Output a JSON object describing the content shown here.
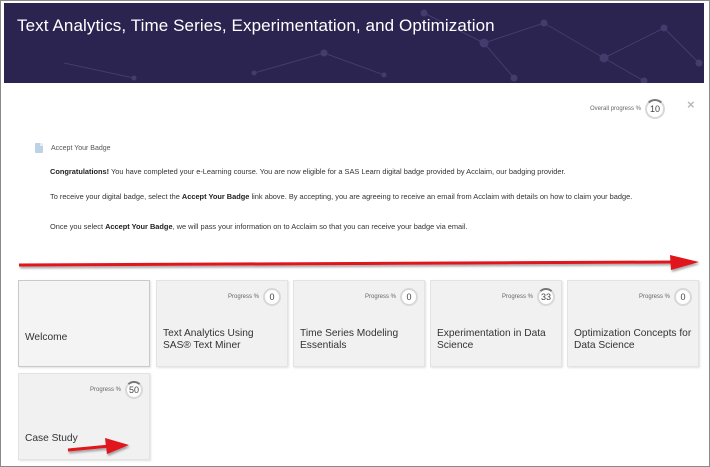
{
  "header": {
    "title": "Text Analytics, Time Series, Experimentation, and Optimization"
  },
  "overall": {
    "label": "Overall progress %",
    "value": "10"
  },
  "close": {
    "glyph": "×"
  },
  "badge": {
    "link_text": "Accept Your Badge",
    "para1_strong": "Congratulations!",
    "para1_rest": " You have completed your e-Learning course. You are now eligible for a SAS Learn digital badge provided by Acclaim, our badging provider.",
    "para2_a": "To receive your digital badge, select the ",
    "para2_strong": "Accept Your Badge",
    "para2_b": " link above.  By accepting, you are agreeing to receive an email from Acclaim with details on how to claim your badge.",
    "para3_a": "Once you select ",
    "para3_strong": "Accept Your Badge",
    "para3_b": ", we will pass your information on to Acclaim so that you can receive your badge via email."
  },
  "cards": [
    {
      "title": "Welcome",
      "show_progress": false
    },
    {
      "title": "Text Analytics Using SAS® Text Miner",
      "progress_label": "Progress %",
      "progress": "0"
    },
    {
      "title": "Time Series Modeling Essentials",
      "progress_label": "Progress %",
      "progress": "0"
    },
    {
      "title": "Experimentation in Data Science",
      "progress_label": "Progress %",
      "progress": "33"
    },
    {
      "title": "Optimization Concepts for Data Science",
      "progress_label": "Progress %",
      "progress": "0"
    },
    {
      "title": "Case Study",
      "progress_label": "Progress %",
      "progress": "50"
    }
  ],
  "colors": {
    "banner": "#2b2450",
    "arrow": "#e0121a"
  }
}
